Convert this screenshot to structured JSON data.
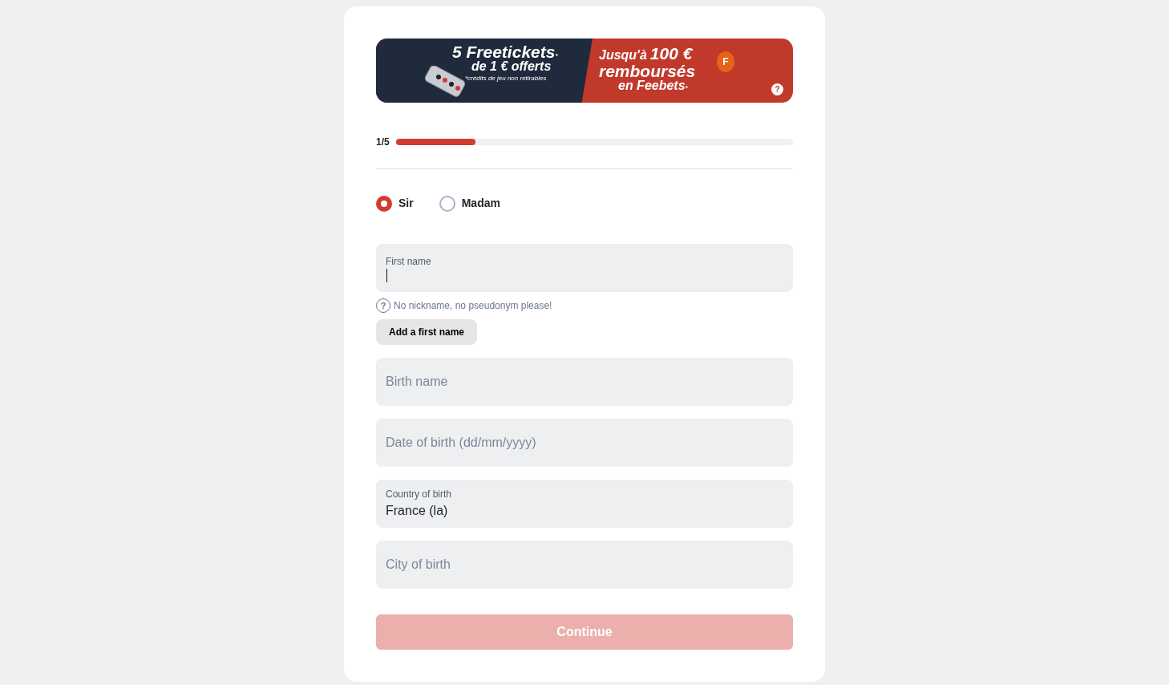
{
  "banner": {
    "left": {
      "headline": "5 Freetickets",
      "star": "*",
      "subline": "de 1 € offerts",
      "note": "*crédits de jeu non retirables"
    },
    "right": {
      "line1_prefix": "Jusqu'à",
      "line1_amount": "100 €",
      "line2": "remboursés",
      "line3": "en Feebets",
      "star": "*",
      "coin_letter": "F",
      "help": "?"
    }
  },
  "progress": {
    "label": "1/5",
    "level": 0.2
  },
  "civility": [
    {
      "label": "Sir",
      "selected": true
    },
    {
      "label": "Madam",
      "selected": false
    }
  ],
  "fields": [
    {
      "kind": "floating",
      "label": "First name",
      "focused": true
    },
    {
      "kind": "placeholder",
      "placeholder": "Birth name"
    },
    {
      "kind": "placeholder",
      "placeholder": "Date of birth (dd/mm/yyyy)"
    },
    {
      "kind": "floating",
      "label": "Country of birth",
      "value": "France (la)",
      "focused": false
    },
    {
      "kind": "placeholder",
      "placeholder": "City of birth"
    }
  ],
  "hint_icon": "?",
  "first_name_hint": "No nickname, no pseudonym please!",
  "add_first_name_button": "Add a first name",
  "continue_button": {
    "label": "Continue",
    "disabled": true
  }
}
